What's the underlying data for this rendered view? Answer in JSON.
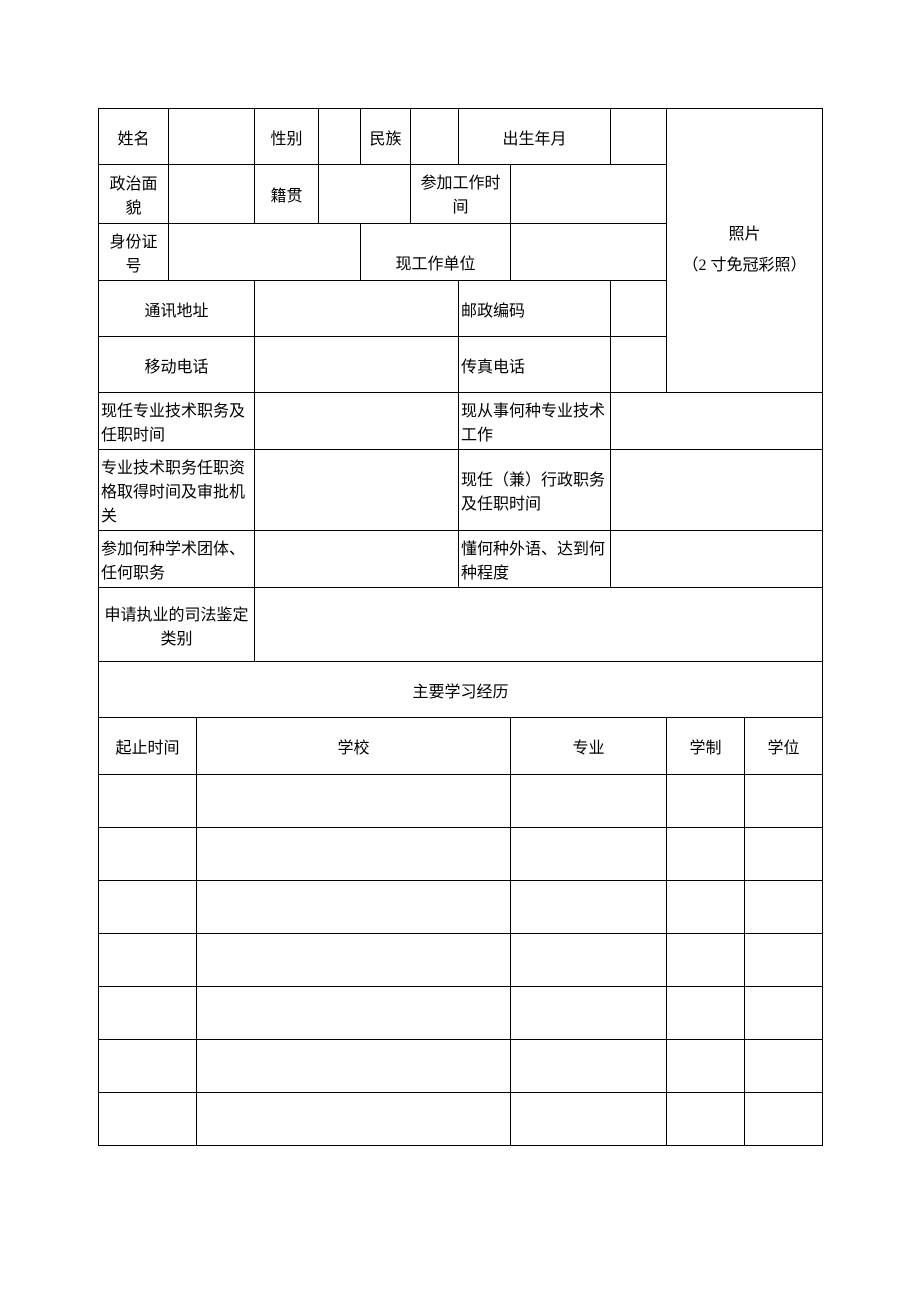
{
  "labels": {
    "name": "姓名",
    "gender": "性别",
    "ethnicity": "民族",
    "birth": "出生年月",
    "political": "政治面\n貌",
    "native_place": "籍贯",
    "work_start": "参加工作时间",
    "id_number": "身份证\n号",
    "current_unit": "现工作单位",
    "address": "通讯地址",
    "postal": "邮政编码",
    "mobile": "移动电话",
    "fax": "传真电话",
    "current_title": "现任专业技术职务及任职时间",
    "current_work_field": "现从事何种专业技术工作",
    "qualification": "专业技术职务任职资格取得时间及审批机关",
    "admin_post": "现任（兼）行政职务及任职时间",
    "academic_org": "参加何种学术团体、任何职务",
    "foreign_lang": "懂何种外语、达到何种程度",
    "apply_category": "申请执业的司法鉴定类别",
    "photo_line1": "照片",
    "photo_line2": "（2 寸免冠彩照）",
    "study_history": "主要学习经历",
    "period": "起止时间",
    "school": "学校",
    "major": "专业",
    "schooling_length": "学制",
    "degree": "学位"
  },
  "values": {
    "name": "",
    "gender": "",
    "ethnicity": "",
    "birth": "",
    "political": "",
    "native_place": "",
    "work_start": "",
    "id_number": "",
    "current_unit": "",
    "address": "",
    "postal": "",
    "mobile": "",
    "fax": "",
    "current_title": "",
    "current_work_field": "",
    "qualification": "",
    "admin_post": "",
    "academic_org": "",
    "foreign_lang": "",
    "apply_category": ""
  },
  "education": [
    {
      "period": "",
      "school": "",
      "major": "",
      "length": "",
      "degree": ""
    },
    {
      "period": "",
      "school": "",
      "major": "",
      "length": "",
      "degree": ""
    },
    {
      "period": "",
      "school": "",
      "major": "",
      "length": "",
      "degree": ""
    },
    {
      "period": "",
      "school": "",
      "major": "",
      "length": "",
      "degree": ""
    },
    {
      "period": "",
      "school": "",
      "major": "",
      "length": "",
      "degree": ""
    },
    {
      "period": "",
      "school": "",
      "major": "",
      "length": "",
      "degree": ""
    },
    {
      "period": "",
      "school": "",
      "major": "",
      "length": "",
      "degree": ""
    }
  ]
}
